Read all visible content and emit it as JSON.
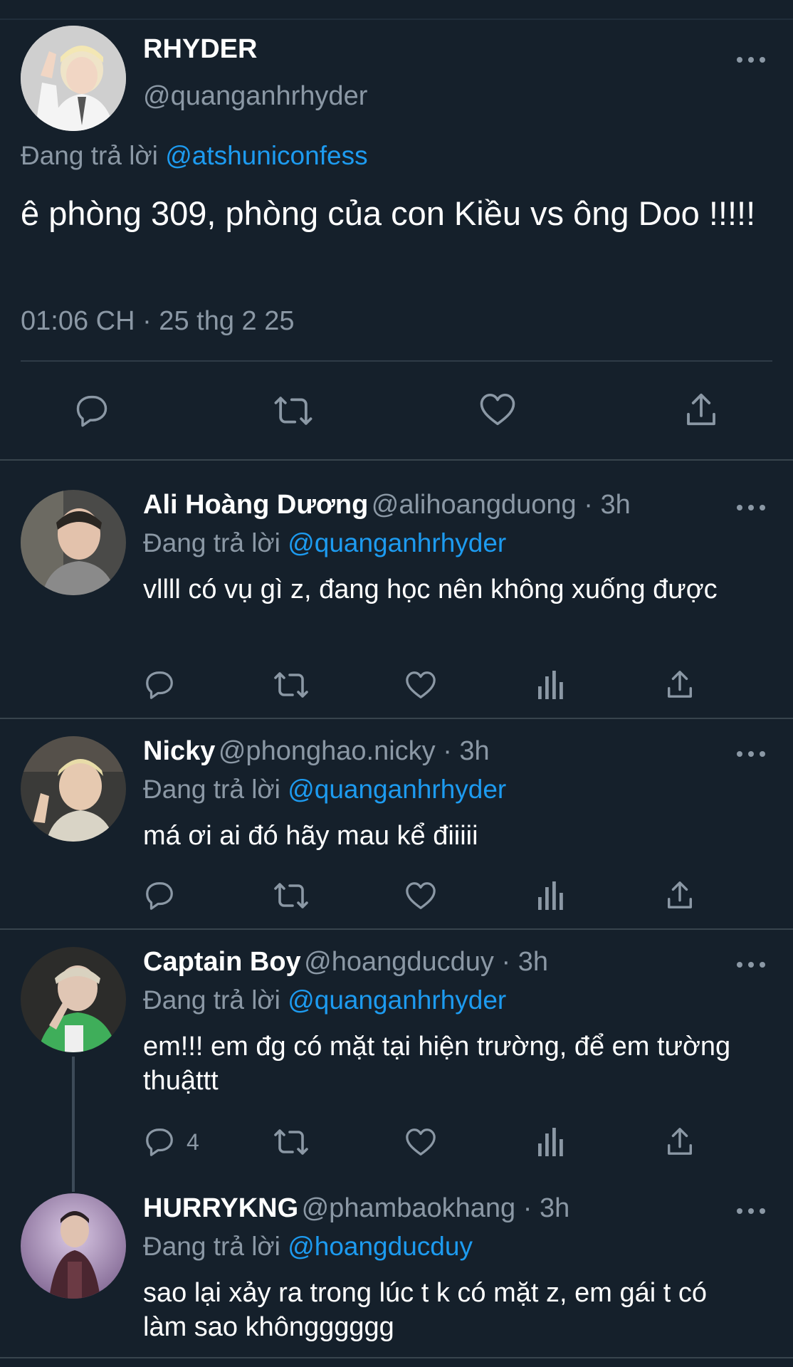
{
  "main_tweet": {
    "name": "RHYDER",
    "handle": "@quanganhrhyder",
    "replying_prefix": "Đang trả lời",
    "replying_to": "@atshuniconfess",
    "text": "ê phòng 309, phòng của con Kiều vs ông Doo !!!!!",
    "timestamp": "01:06 CH · 25 thg 2 25",
    "actions": [
      "reply-icon",
      "retweet-icon",
      "like-icon",
      "share-icon"
    ]
  },
  "replies": [
    {
      "name": "Ali Hoàng Dương",
      "handle": "@alihoangduong · 3h",
      "replying_prefix": "Đang trả lời",
      "replying_to": "@quanganhrhyder",
      "text": "vllll có vụ gì z, đang học nên không xuống được",
      "reply_count": ""
    },
    {
      "name": "Nicky",
      "handle": "@phonghao.nicky · 3h",
      "replying_prefix": "Đang trả lời",
      "replying_to": "@quanganhrhyder",
      "text": "má ơi ai đó hãy mau kể điiiii",
      "reply_count": ""
    },
    {
      "name": "Captain Boy",
      "handle": "@hoangducduy · 3h",
      "replying_prefix": "Đang trả lời",
      "replying_to": "@quanganhrhyder",
      "text": "em!!! em đg có mặt tại hiện trường, để em tường thuậttt",
      "reply_count": "4"
    },
    {
      "name": "HURRYKNG",
      "handle": "@phambaokhang · 3h",
      "replying_prefix": "Đang trả lời",
      "replying_to": "@hoangducduy",
      "text": "sao lại xảy ra trong lúc t k có mặt z, em gái t có làm sao khôngggggg",
      "reply_count": ""
    }
  ],
  "colors": {
    "background": "#15202b",
    "text": "#ffffff",
    "muted": "#8b98a5",
    "link": "#1d9bf0",
    "divider": "#2f3b47"
  }
}
